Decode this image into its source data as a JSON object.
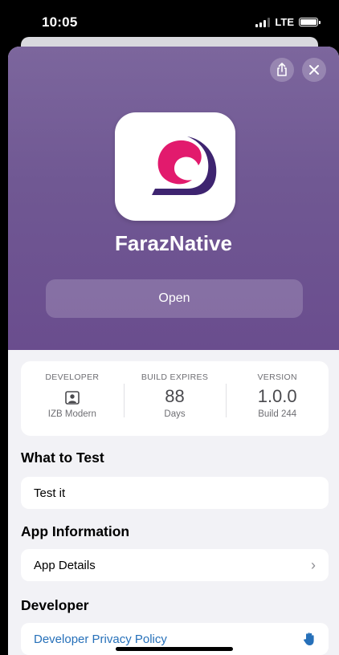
{
  "status_bar": {
    "time": "10:05",
    "network": "LTE"
  },
  "header_actions": {
    "share_icon": "share-icon",
    "close_icon": "close-icon"
  },
  "app": {
    "name": "FarazNative",
    "open_label": "Open",
    "icon": "app-icon",
    "colors": {
      "accent": "#6a4d8e",
      "logo_primary": "#e21a6d",
      "logo_secondary": "#3e2470"
    }
  },
  "info": {
    "developer": {
      "label": "DEVELOPER",
      "icon": "person-icon",
      "value": "IZB Modern"
    },
    "build_expires": {
      "label": "BUILD EXPIRES",
      "value": "88",
      "unit": "Days"
    },
    "version": {
      "label": "VERSION",
      "value": "1.0.0",
      "build": "Build 244"
    }
  },
  "what_to_test": {
    "title": "What to Test",
    "text": "Test it"
  },
  "app_information": {
    "title": "App Information",
    "row_label": "App Details"
  },
  "developer_section": {
    "title": "Developer",
    "link_label": "Developer Privacy Policy",
    "icon": "hand-icon"
  }
}
